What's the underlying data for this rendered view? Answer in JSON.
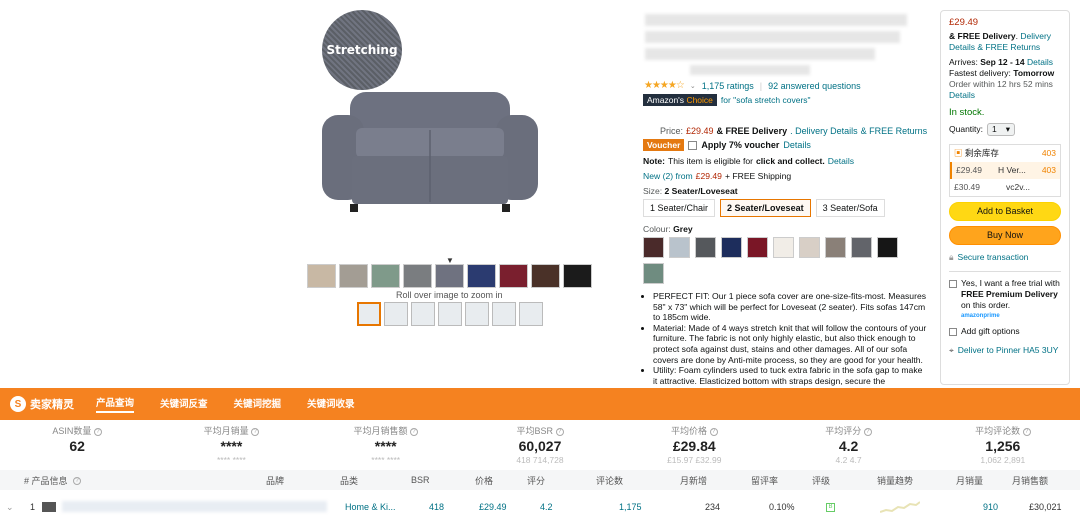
{
  "hero": {
    "badge_text": "Stretching",
    "roll_over_text": "Roll over image to zoom in",
    "swatch_colors": [
      "#c8b8a4",
      "#a39d94",
      "#7f9a8a",
      "#7a7d80",
      "#6f7280",
      "#2b3b70",
      "#7a1f2e",
      "#4a3128",
      "#1b1b1b"
    ]
  },
  "title": {
    "ratings": "1,175 ratings",
    "answered": "92 answered questions",
    "choice_label": "Amazon's",
    "choice_highlight": "Choice",
    "choice_for": "for \"sofa stretch covers\"",
    "price_label": "Price:",
    "price": "£29.49",
    "free_delivery": "& FREE Delivery",
    "delivery_details": ". Delivery Details",
    "free_returns": "& FREE Returns",
    "voucher": "Voucher",
    "voucher_apply": "Apply 7% voucher",
    "voucher_details": "Details",
    "note_label": "Note:",
    "note_text": "This item is eligible for",
    "note_bold": "click and collect.",
    "note_details": "Details",
    "new_from": "New (2) from",
    "new_price": "£29.49",
    "new_shipping": "+ FREE Shipping",
    "size_label": "Size:",
    "size_value": "2 Seater/Loveseat",
    "sizes": [
      "1 Seater/Chair",
      "2 Seater/Loveseat",
      "3 Seater/Sofa"
    ],
    "colour_label": "Colour:",
    "colour_value": "Grey",
    "colour_swatches": [
      "#4a2a2a",
      "#b9c3cc",
      "#55585c",
      "#1d2d5c",
      "#7a1626",
      "#f1ede7",
      "#d8cfc6",
      "#8a8078",
      "#62646a",
      "#161616",
      "#6f8c80"
    ]
  },
  "bullets": [
    "PERFECT FIT: Our 1 piece sofa cover are one-size-fits-most. Measures 58\" x 73\" which will be perfect for Loveseat (2 seater). Fits sofas 147cm to 185cm wide.",
    "Material: Made of 4 ways stretch knit that will follow the contours of your furniture. The fabric is not only highly elastic, but also thick enough to protect sofa against dust, stains and other damages. All of our sofa covers are done by Anti-mite process, so they are good for your health.",
    "Utility: Foam cylinders used to tuck extra fabric in the sofa gap to make it attractive. Elasticized bottom with straps design, secure the"
  ],
  "buybox": {
    "price": "£29.49",
    "free_delivery": "& FREE Delivery",
    "delivery_link": "Delivery Details",
    "free_returns": "& FREE Returns",
    "arrives_label": "Arrives:",
    "arrives_value": "Sep 12 - 14",
    "arrives_details": "Details",
    "fastest_label": "Fastest delivery:",
    "fastest_value": "Tomorrow",
    "order_within": "Order within 12 hrs 52 mins",
    "order_details": "Details",
    "in_stock": "In stock.",
    "quantity_label": "Quantity:",
    "quantity_value": "1",
    "offers": [
      {
        "left": "剩余库存",
        "right": "403"
      },
      {
        "left": "£29.49",
        "mid": "H Ver...",
        "right": "403"
      },
      {
        "left": "£30.49",
        "mid": "vc2v...",
        "right": ""
      }
    ],
    "add_to_basket": "Add to Basket",
    "buy_now": "Buy Now",
    "secure": "Secure transaction",
    "prime_yes": "Yes, I want a free trial with",
    "prime_bold": "FREE Premium Delivery",
    "prime_tail": "on this order.",
    "prime_logo": "amazonprime",
    "gift": "Add gift options",
    "deliver_to": "Deliver to Pinner HA5 3UY"
  },
  "plugin": {
    "logo": "卖家精灵",
    "tabs": [
      "产品查询",
      "关键词反查",
      "关键词挖掘",
      "关键词收录"
    ]
  },
  "stats": [
    {
      "label": "ASIN数量",
      "value": "62",
      "sub": ""
    },
    {
      "label": "平均月销量",
      "value": "****",
      "sub": "****  ****"
    },
    {
      "label": "平均月销售额",
      "value": "****",
      "sub": "****  ****"
    },
    {
      "label": "平均BSR",
      "value": "60,027",
      "sub": "418   714,728"
    },
    {
      "label": "平均价格",
      "value": "£29.84",
      "sub": "£15.97   £32.99"
    },
    {
      "label": "平均评分",
      "value": "4.2",
      "sub": "4.2   4.7"
    },
    {
      "label": "平均评论数",
      "value": "1,256",
      "sub": "1,062   2,891"
    }
  ],
  "table": {
    "headers": [
      "# 产品信息",
      "品牌",
      "品类",
      "BSR",
      "价格",
      "评分",
      "评论数",
      "月新增",
      "留评率",
      "评级",
      "销量趋势",
      "月销量",
      "月销售额"
    ],
    "row": {
      "index": "1",
      "category": "Home & Ki...",
      "bsr": "418",
      "price": "£29.49",
      "rating": "4.2",
      "reviews": "1,175",
      "new": "234",
      "review_rate": "0.10%",
      "grade": "B",
      "monthly_sales": "910",
      "monthly_revenue": "£30,021"
    }
  }
}
